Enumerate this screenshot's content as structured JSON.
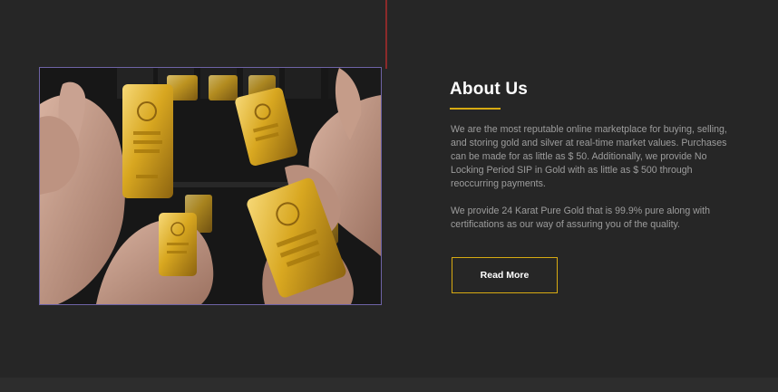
{
  "about": {
    "title": "About Us",
    "paragraph_1": "We are the most reputable online marketplace for buying, selling, and storing gold and silver at real-time market values. Purchases can be made for as little as $ 50. Additionally, we provide No Locking Period SIP in Gold with as little as $ 500 through reoccurring payments.",
    "paragraph_2": "We provide 24 Karat Pure Gold that is 99.9% pure along with certifications as our way of assuring you of the quality.",
    "read_more_label": "Read More"
  },
  "colors": {
    "background": "#262626",
    "accent_gold": "#d7aa12",
    "top_line": "#8b2a2a",
    "image_border": "#6e63a6"
  },
  "image": {
    "subject": "gold-bars-in-hands"
  }
}
